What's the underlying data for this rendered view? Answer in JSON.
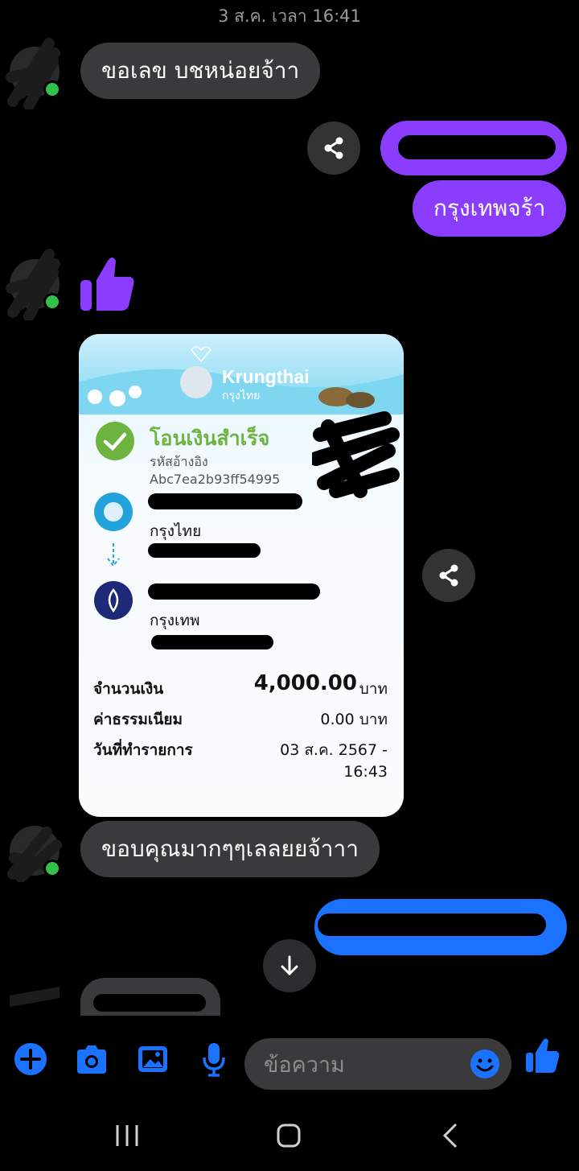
{
  "conversation": {
    "timestamp": "3 ส.ค. เวลา 16:41",
    "messages": {
      "m1": "ขอเลข บชหน่อยจ้าา",
      "m3": "กรุงเทพจร้า",
      "m5": "ขอบคุณมากๆๆเลลยยจ้าาา"
    }
  },
  "receipt": {
    "brand": "Krungthai",
    "brand_th": "กรุงไทย",
    "status": "โอนเงินสำเร็จ",
    "ref_label": "รหัสอ้างอิง",
    "ref_value": "Abc7ea2b93ff54995",
    "from_bank": "กรุงไทย",
    "to_bank": "กรุงเทพ",
    "amount_label": "จำนวนเงิน",
    "amount_value": "4,000.00",
    "amount_unit": "บาท",
    "fee_label": "ค่าธรรมเนียม",
    "fee_value": "0.00 บาท",
    "date_label": "วันที่ทำรายการ",
    "date_value": "03 ส.ค. 2567 -",
    "time_value": "16:43"
  },
  "composer": {
    "placeholder": "ข้อความ"
  },
  "colors": {
    "outgoing": "#8b3dff",
    "outgoing_blue": "#1a72ff",
    "incoming": "#3a3a3c",
    "accent": "#1a72ff",
    "success": "#6db33f"
  }
}
